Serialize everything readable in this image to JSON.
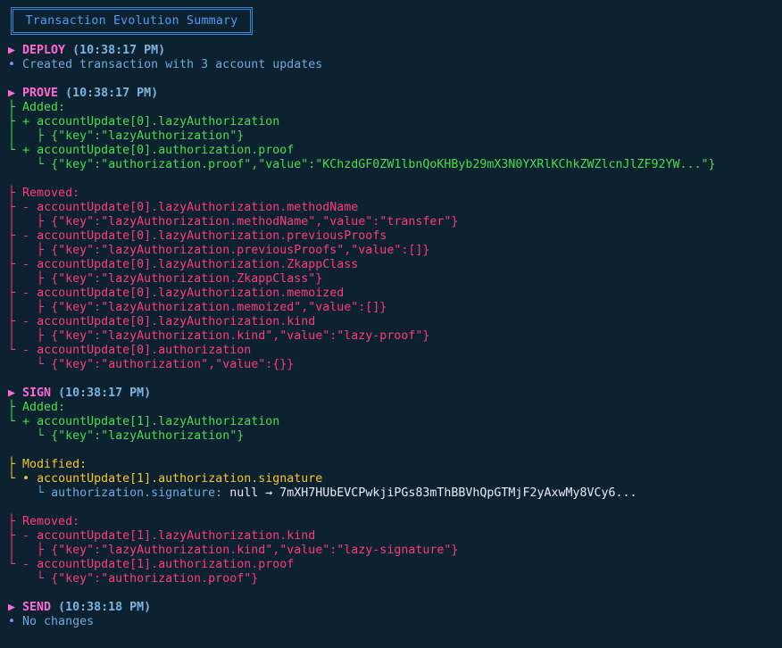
{
  "title": "Transaction Evolution Summary",
  "sections": {
    "deploy": {
      "name": "DEPLOY",
      "time": "(10:38:17 PM)",
      "summary": "Created transaction with 3 account updates"
    },
    "prove": {
      "name": "PROVE",
      "time": "(10:38:17 PM)",
      "added_label": "Added:",
      "added": [
        {
          "path": "accountUpdate[0].lazyAuthorization",
          "detail": "{\"key\":\"lazyAuthorization\"}"
        },
        {
          "path": "accountUpdate[0].authorization.proof",
          "detail": "{\"key\":\"authorization.proof\",\"value\":\"KChzdGF0ZW1lbnQoKHByb29mX3N0YXRlKChkZWZlcnJlZF92YW...\"}"
        }
      ],
      "removed_label": "Removed:",
      "removed": [
        {
          "path": "accountUpdate[0].lazyAuthorization.methodName",
          "detail": "{\"key\":\"lazyAuthorization.methodName\",\"value\":\"transfer\"}"
        },
        {
          "path": "accountUpdate[0].lazyAuthorization.previousProofs",
          "detail": "{\"key\":\"lazyAuthorization.previousProofs\",\"value\":[]}"
        },
        {
          "path": "accountUpdate[0].lazyAuthorization.ZkappClass",
          "detail": "{\"key\":\"lazyAuthorization.ZkappClass\"}"
        },
        {
          "path": "accountUpdate[0].lazyAuthorization.memoized",
          "detail": "{\"key\":\"lazyAuthorization.memoized\",\"value\":[]}"
        },
        {
          "path": "accountUpdate[0].lazyAuthorization.kind",
          "detail": "{\"key\":\"lazyAuthorization.kind\",\"value\":\"lazy-proof\"}"
        },
        {
          "path": "accountUpdate[0].authorization",
          "detail": "{\"key\":\"authorization\",\"value\":{}}"
        }
      ]
    },
    "sign": {
      "name": "SIGN",
      "time": "(10:38:17 PM)",
      "added_label": "Added:",
      "added": [
        {
          "path": "accountUpdate[1].lazyAuthorization",
          "detail": "{\"key\":\"lazyAuthorization\"}"
        }
      ],
      "modified_label": "Modified:",
      "modified": [
        {
          "path": "accountUpdate[1].authorization.signature",
          "field": "authorization.signature:",
          "change": "null → 7mXH7HUbEVCPwkjiPGs83mThBBVhQpGTMjF2yAxwMy8VCy6..."
        }
      ],
      "removed_label": "Removed:",
      "removed": [
        {
          "path": "accountUpdate[1].lazyAuthorization.kind",
          "detail": "{\"key\":\"lazyAuthorization.kind\",\"value\":\"lazy-signature\"}"
        },
        {
          "path": "accountUpdate[1].authorization.proof",
          "detail": "{\"key\":\"authorization.proof\"}"
        }
      ]
    },
    "send": {
      "name": "SEND",
      "time": "(10:38:18 PM)",
      "summary": "No changes"
    }
  },
  "glyphs": {
    "arrow": "▶",
    "bullet": "•",
    "branch": "├",
    "last": "└",
    "plus": "+",
    "minus": "-",
    "dot": "•"
  },
  "colors": {
    "background": "#0c2231",
    "section": "#ff6ad5",
    "added": "#4ade4a",
    "removed": "#ff3b7a",
    "modified": "#f8c52c",
    "info": "#6fa8dc"
  }
}
